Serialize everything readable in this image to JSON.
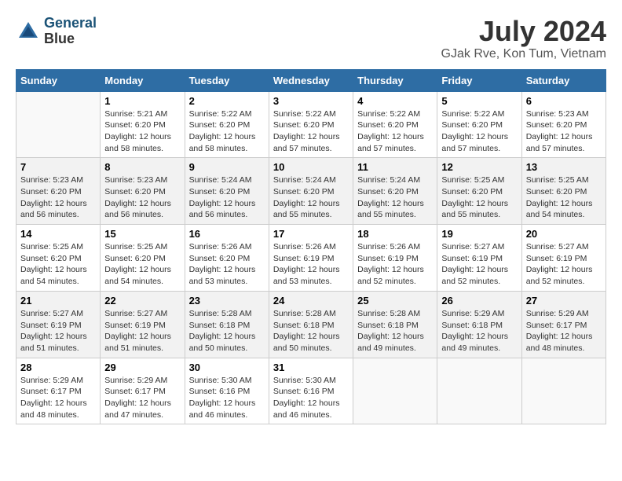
{
  "header": {
    "logo_line1": "General",
    "logo_line2": "Blue",
    "month_year": "July 2024",
    "location": "GJak Rve, Kon Tum, Vietnam"
  },
  "weekdays": [
    "Sunday",
    "Monday",
    "Tuesday",
    "Wednesday",
    "Thursday",
    "Friday",
    "Saturday"
  ],
  "weeks": [
    [
      {
        "day": "",
        "info": ""
      },
      {
        "day": "1",
        "info": "Sunrise: 5:21 AM\nSunset: 6:20 PM\nDaylight: 12 hours\nand 58 minutes."
      },
      {
        "day": "2",
        "info": "Sunrise: 5:22 AM\nSunset: 6:20 PM\nDaylight: 12 hours\nand 58 minutes."
      },
      {
        "day": "3",
        "info": "Sunrise: 5:22 AM\nSunset: 6:20 PM\nDaylight: 12 hours\nand 57 minutes."
      },
      {
        "day": "4",
        "info": "Sunrise: 5:22 AM\nSunset: 6:20 PM\nDaylight: 12 hours\nand 57 minutes."
      },
      {
        "day": "5",
        "info": "Sunrise: 5:22 AM\nSunset: 6:20 PM\nDaylight: 12 hours\nand 57 minutes."
      },
      {
        "day": "6",
        "info": "Sunrise: 5:23 AM\nSunset: 6:20 PM\nDaylight: 12 hours\nand 57 minutes."
      }
    ],
    [
      {
        "day": "7",
        "info": "Sunrise: 5:23 AM\nSunset: 6:20 PM\nDaylight: 12 hours\nand 56 minutes."
      },
      {
        "day": "8",
        "info": "Sunrise: 5:23 AM\nSunset: 6:20 PM\nDaylight: 12 hours\nand 56 minutes."
      },
      {
        "day": "9",
        "info": "Sunrise: 5:24 AM\nSunset: 6:20 PM\nDaylight: 12 hours\nand 56 minutes."
      },
      {
        "day": "10",
        "info": "Sunrise: 5:24 AM\nSunset: 6:20 PM\nDaylight: 12 hours\nand 55 minutes."
      },
      {
        "day": "11",
        "info": "Sunrise: 5:24 AM\nSunset: 6:20 PM\nDaylight: 12 hours\nand 55 minutes."
      },
      {
        "day": "12",
        "info": "Sunrise: 5:25 AM\nSunset: 6:20 PM\nDaylight: 12 hours\nand 55 minutes."
      },
      {
        "day": "13",
        "info": "Sunrise: 5:25 AM\nSunset: 6:20 PM\nDaylight: 12 hours\nand 54 minutes."
      }
    ],
    [
      {
        "day": "14",
        "info": "Sunrise: 5:25 AM\nSunset: 6:20 PM\nDaylight: 12 hours\nand 54 minutes."
      },
      {
        "day": "15",
        "info": "Sunrise: 5:25 AM\nSunset: 6:20 PM\nDaylight: 12 hours\nand 54 minutes."
      },
      {
        "day": "16",
        "info": "Sunrise: 5:26 AM\nSunset: 6:20 PM\nDaylight: 12 hours\nand 53 minutes."
      },
      {
        "day": "17",
        "info": "Sunrise: 5:26 AM\nSunset: 6:19 PM\nDaylight: 12 hours\nand 53 minutes."
      },
      {
        "day": "18",
        "info": "Sunrise: 5:26 AM\nSunset: 6:19 PM\nDaylight: 12 hours\nand 52 minutes."
      },
      {
        "day": "19",
        "info": "Sunrise: 5:27 AM\nSunset: 6:19 PM\nDaylight: 12 hours\nand 52 minutes."
      },
      {
        "day": "20",
        "info": "Sunrise: 5:27 AM\nSunset: 6:19 PM\nDaylight: 12 hours\nand 52 minutes."
      }
    ],
    [
      {
        "day": "21",
        "info": "Sunrise: 5:27 AM\nSunset: 6:19 PM\nDaylight: 12 hours\nand 51 minutes."
      },
      {
        "day": "22",
        "info": "Sunrise: 5:27 AM\nSunset: 6:19 PM\nDaylight: 12 hours\nand 51 minutes."
      },
      {
        "day": "23",
        "info": "Sunrise: 5:28 AM\nSunset: 6:18 PM\nDaylight: 12 hours\nand 50 minutes."
      },
      {
        "day": "24",
        "info": "Sunrise: 5:28 AM\nSunset: 6:18 PM\nDaylight: 12 hours\nand 50 minutes."
      },
      {
        "day": "25",
        "info": "Sunrise: 5:28 AM\nSunset: 6:18 PM\nDaylight: 12 hours\nand 49 minutes."
      },
      {
        "day": "26",
        "info": "Sunrise: 5:29 AM\nSunset: 6:18 PM\nDaylight: 12 hours\nand 49 minutes."
      },
      {
        "day": "27",
        "info": "Sunrise: 5:29 AM\nSunset: 6:17 PM\nDaylight: 12 hours\nand 48 minutes."
      }
    ],
    [
      {
        "day": "28",
        "info": "Sunrise: 5:29 AM\nSunset: 6:17 PM\nDaylight: 12 hours\nand 48 minutes."
      },
      {
        "day": "29",
        "info": "Sunrise: 5:29 AM\nSunset: 6:17 PM\nDaylight: 12 hours\nand 47 minutes."
      },
      {
        "day": "30",
        "info": "Sunrise: 5:30 AM\nSunset: 6:16 PM\nDaylight: 12 hours\nand 46 minutes."
      },
      {
        "day": "31",
        "info": "Sunrise: 5:30 AM\nSunset: 6:16 PM\nDaylight: 12 hours\nand 46 minutes."
      },
      {
        "day": "",
        "info": ""
      },
      {
        "day": "",
        "info": ""
      },
      {
        "day": "",
        "info": ""
      }
    ]
  ]
}
